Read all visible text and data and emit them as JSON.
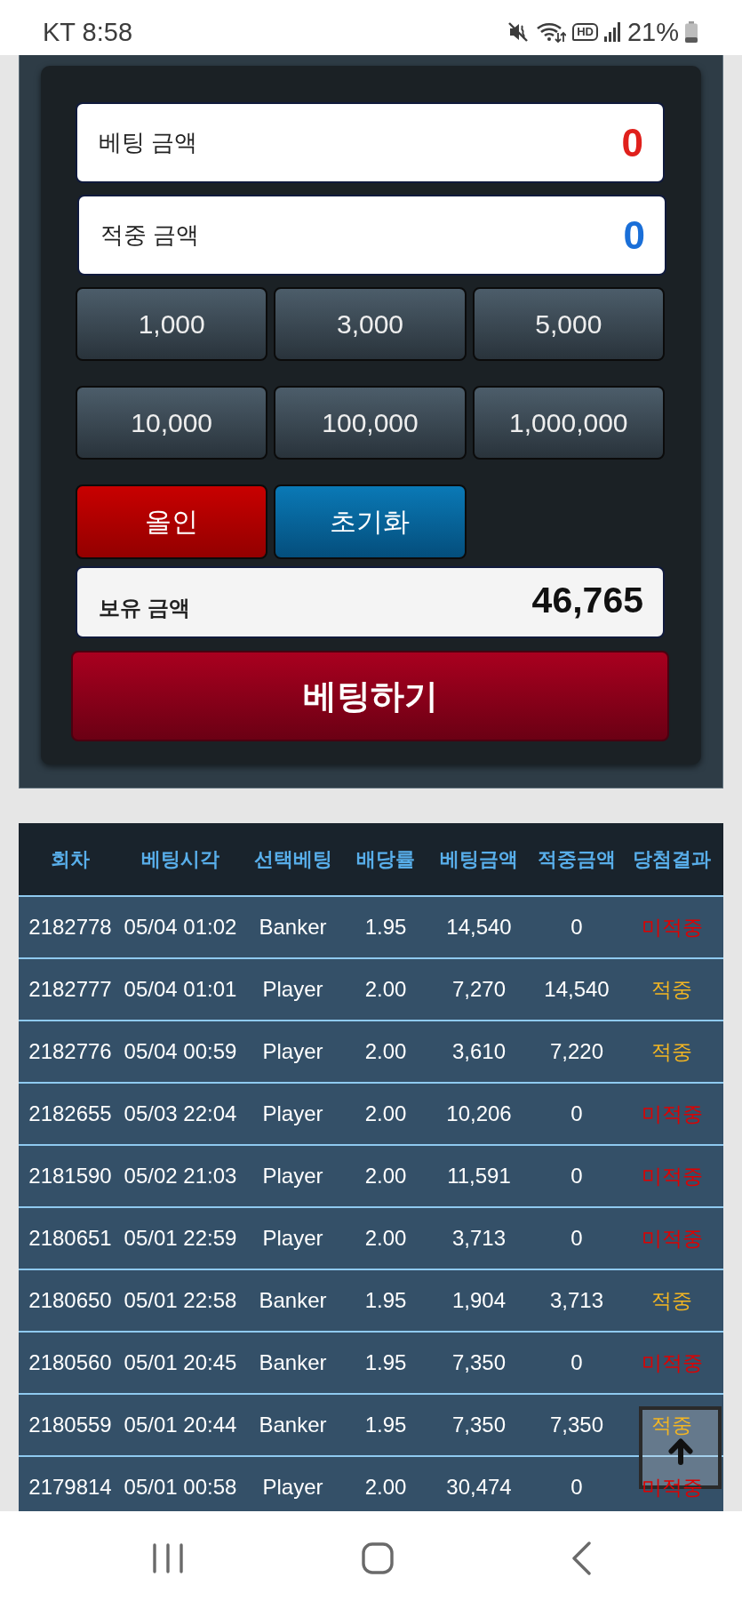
{
  "status_bar": {
    "carrier_time": "KT 8:58",
    "hd_label": "HD",
    "battery": "21%"
  },
  "bet_panel": {
    "bet_amount": {
      "label": "베팅 금액",
      "value": "0"
    },
    "win_amount": {
      "label": "적중 금액",
      "value": "0"
    },
    "chips": [
      "1,000",
      "3,000",
      "5,000",
      "10,000",
      "100,000",
      "1,000,000"
    ],
    "actions": [
      {
        "label": "올인",
        "kind": "all_in"
      },
      {
        "label": "초기화",
        "kind": "reset"
      }
    ],
    "balance": {
      "label": "보유 금액",
      "value": "46,765"
    },
    "submit": "베팅하기"
  },
  "history": {
    "columns": [
      "회차",
      "베팅시각",
      "선택베팅",
      "배당률",
      "베팅금액",
      "적중금액",
      "당첨결과"
    ],
    "rows": [
      {
        "cells": [
          "2182778",
          "05/04 01:02",
          "Banker",
          "1.95",
          "14,540",
          "0"
        ],
        "result": "미적중",
        "won": false
      },
      {
        "cells": [
          "2182777",
          "05/04 01:01",
          "Player",
          "2.00",
          "7,270",
          "14,540"
        ],
        "result": "적중",
        "won": true
      },
      {
        "cells": [
          "2182776",
          "05/04 00:59",
          "Player",
          "2.00",
          "3,610",
          "7,220"
        ],
        "result": "적중",
        "won": true
      },
      {
        "cells": [
          "2182655",
          "05/03 22:04",
          "Player",
          "2.00",
          "10,206",
          "0"
        ],
        "result": "미적중",
        "won": false
      },
      {
        "cells": [
          "2181590",
          "05/02 21:03",
          "Player",
          "2.00",
          "11,591",
          "0"
        ],
        "result": "미적중",
        "won": false
      },
      {
        "cells": [
          "2180651",
          "05/01 22:59",
          "Player",
          "2.00",
          "3,713",
          "0"
        ],
        "result": "미적중",
        "won": false
      },
      {
        "cells": [
          "2180650",
          "05/01 22:58",
          "Banker",
          "1.95",
          "1,904",
          "3,713"
        ],
        "result": "적중",
        "won": true
      },
      {
        "cells": [
          "2180560",
          "05/01 20:45",
          "Banker",
          "1.95",
          "7,350",
          "0"
        ],
        "result": "미적중",
        "won": false
      },
      {
        "cells": [
          "2180559",
          "05/01 20:44",
          "Banker",
          "1.95",
          "7,350",
          "7,350"
        ],
        "result": "적중",
        "won": true
      },
      {
        "cells": [
          "2179814",
          "05/01 00:58",
          "Player",
          "2.00",
          "30,474",
          "0"
        ],
        "result": "미적중",
        "won": false
      }
    ]
  }
}
